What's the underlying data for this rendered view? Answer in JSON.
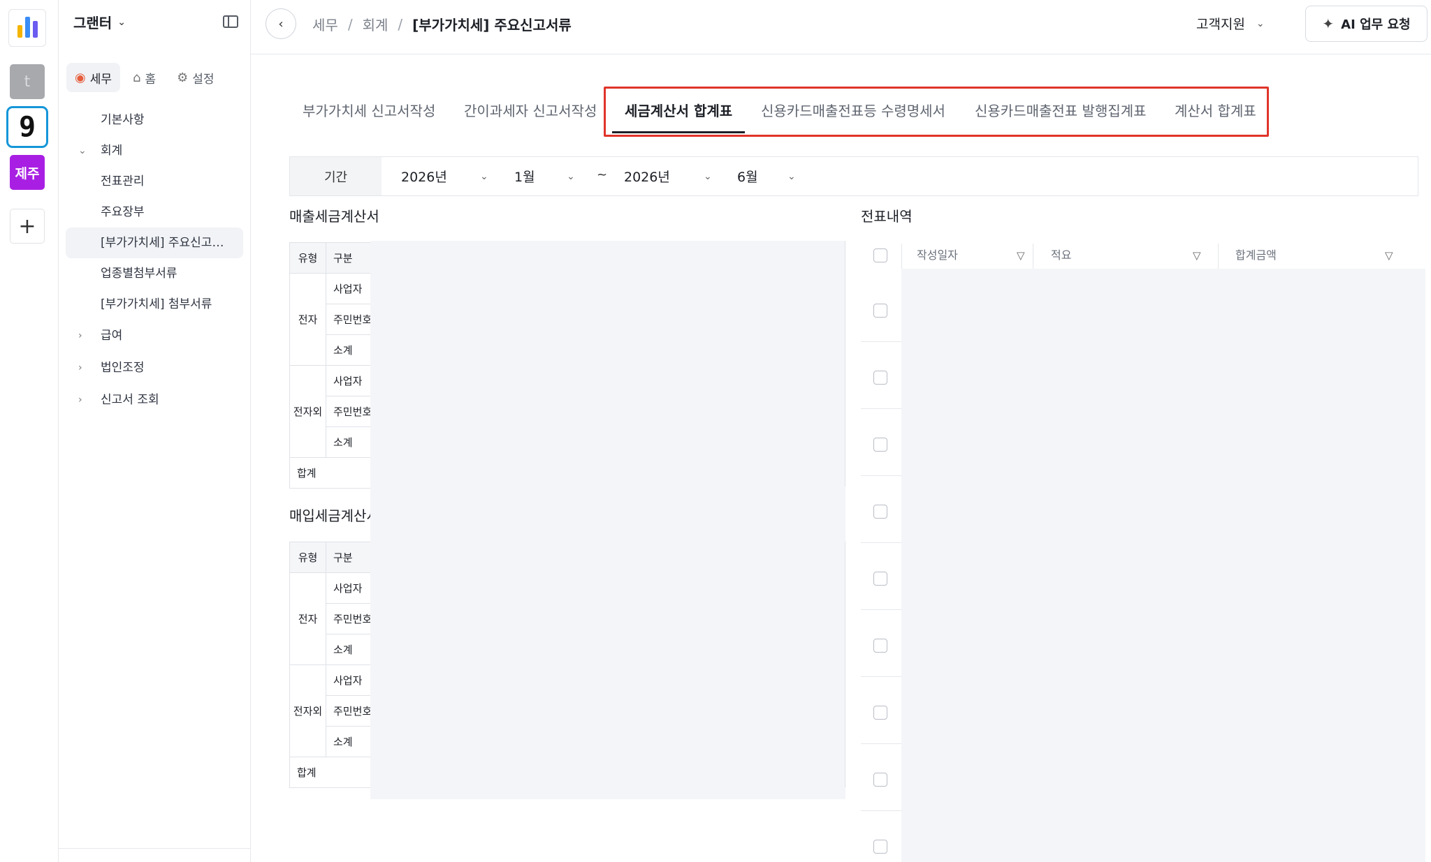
{
  "rail": {
    "apps": [
      {
        "name": "app-logo",
        "label": ""
      },
      {
        "name": "workspace-t",
        "label": "t"
      },
      {
        "name": "workspace-9",
        "label": "9"
      },
      {
        "name": "workspace-jeju",
        "label": "제주"
      }
    ],
    "add_label": "+",
    "colors": {
      "accent": "#1596d8",
      "jeju": "#a81fe3"
    }
  },
  "sidebar": {
    "org_name": "그랜터",
    "tabs": [
      {
        "label": "세무",
        "icon": "tax-icon"
      },
      {
        "label": "홈",
        "icon": "home-icon"
      },
      {
        "label": "설정",
        "icon": "gear-icon"
      }
    ],
    "items": [
      {
        "label": "기본사항"
      },
      {
        "label": "회계"
      },
      {
        "label": "전표관리"
      },
      {
        "label": "주요장부"
      },
      {
        "label": "[부가가치세] 주요신고서류"
      },
      {
        "label": "업종별첨부서류"
      },
      {
        "label": "[부가가치세] 첨부서류"
      },
      {
        "label": "급여"
      },
      {
        "label": "법인조정"
      },
      {
        "label": "신고서 조회"
      }
    ]
  },
  "header": {
    "breadcrumb": [
      "세무",
      "회계",
      "[부가가치세] 주요신고서류"
    ],
    "support_label": "고객지원",
    "ai_button_label": "AI 업무 요청"
  },
  "tabs": [
    {
      "label": "부가가치세 신고서작성",
      "active": false
    },
    {
      "label": "간이과세자 신고서작성",
      "active": false
    },
    {
      "label": "세금계산서 합계표",
      "active": true
    },
    {
      "label": "신용카드매출전표등 수령명세서",
      "active": false
    },
    {
      "label": "신용카드매출전표 발행집계표",
      "active": false
    },
    {
      "label": "계산서 합계표",
      "active": false
    }
  ],
  "filter": {
    "label": "기간",
    "start_year": "2026년",
    "start_month": "1월",
    "tilde": "~",
    "end_year": "2026년",
    "end_month": "6월"
  },
  "sales": {
    "title": "매출세금계산서",
    "header": {
      "type": "유형",
      "kind": "구분"
    },
    "groups": [
      {
        "type": "전자",
        "rows": [
          "사업자",
          "주민번호",
          "소계"
        ]
      },
      {
        "type": "전자외",
        "rows": [
          "사업자",
          "주민번호",
          "소계"
        ]
      }
    ],
    "total_label": "합계"
  },
  "purchase": {
    "title": "매입세금계산서",
    "header": {
      "type": "유형",
      "kind": "구분"
    },
    "groups": [
      {
        "type": "전자",
        "rows": [
          "사업자",
          "주민번호",
          "소계"
        ]
      },
      {
        "type": "전자외",
        "rows": [
          "사업자",
          "주민번호",
          "소계"
        ]
      }
    ],
    "total_label": "합계"
  },
  "journal": {
    "title": "전표내역",
    "columns": [
      "작성일자",
      "적요",
      "합계금액"
    ],
    "row_count": 9
  }
}
